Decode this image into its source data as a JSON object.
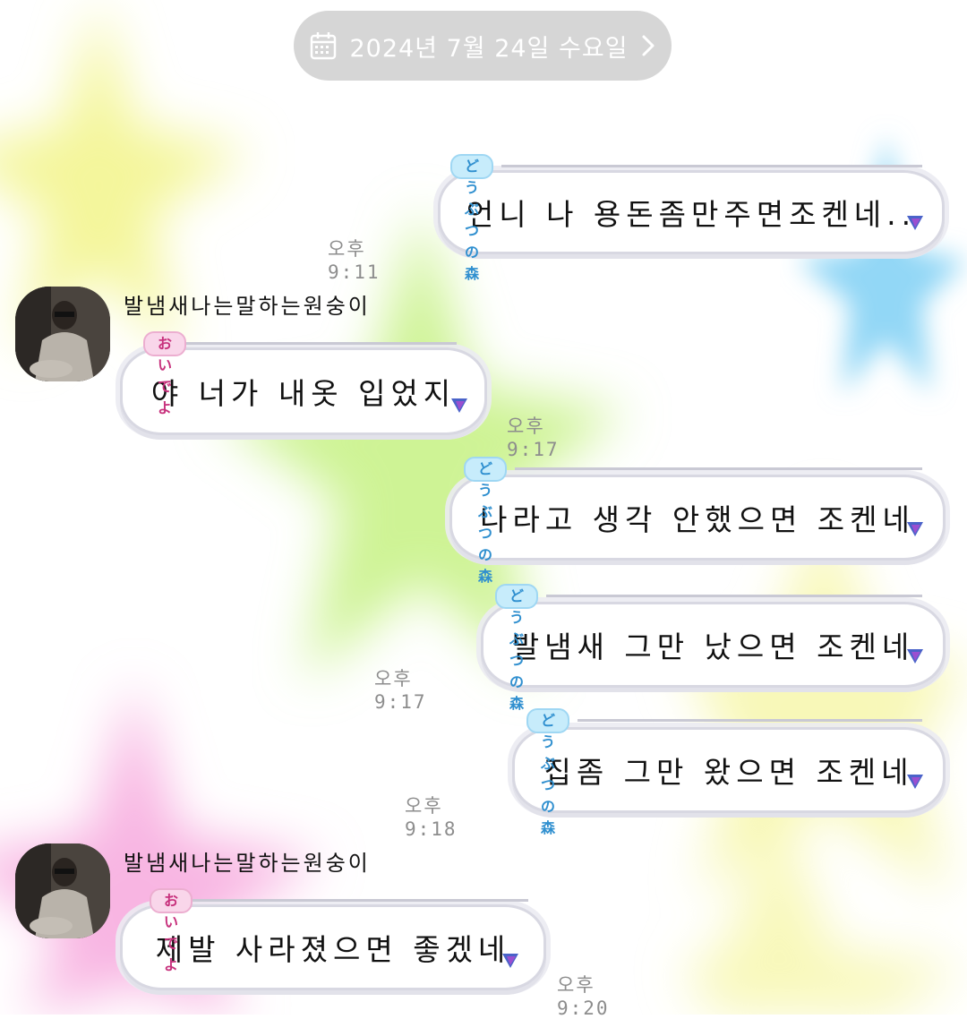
{
  "header": {
    "date_label": "2024년 7월 24일 수요일",
    "calendar_icon": "calendar-icon",
    "next_icon": "chevron-right-icon"
  },
  "colors": {
    "bubble_border": "#d8d8e2",
    "tag_blue_bg": "#c7ecfb",
    "tag_blue_text": "#2f8fcf",
    "tag_pink_bg": "#f9d6ea",
    "tag_pink_text": "#c7307c",
    "arrow_blue": "#4a63c9",
    "arrow_purple": "#9b4fd0",
    "date_pill_bg": "#c8c8c8"
  },
  "messages": [
    {
      "direction": "outgoing",
      "tag": "どうぶつの森",
      "text": "언니 나 용돈좀만주면조켄네..",
      "time": "오후 9:11"
    },
    {
      "direction": "incoming",
      "sender": "발냄새나는말하는원숭이",
      "tag": "おいでよ",
      "text": "야 너가 내옷 입었지",
      "time": "오후 9:17"
    },
    {
      "direction": "outgoing",
      "tag": "どうぶつの森",
      "text": "나라고 생각 안했으면 조켄네",
      "time": ""
    },
    {
      "direction": "outgoing",
      "tag": "どうぶつの森",
      "text": "발냄새 그만 났으면 조켄네",
      "time": "오후 9:17"
    },
    {
      "direction": "outgoing",
      "tag": "どうぶつの森",
      "text": "집좀 그만 왔으면 조켄네",
      "time": "오후 9:18"
    },
    {
      "direction": "incoming",
      "sender": "발냄새나는말하는원숭이",
      "tag": "おいでよ",
      "text": "제발 사라졌으면 좋겠네",
      "time": "오후 9:20"
    }
  ]
}
